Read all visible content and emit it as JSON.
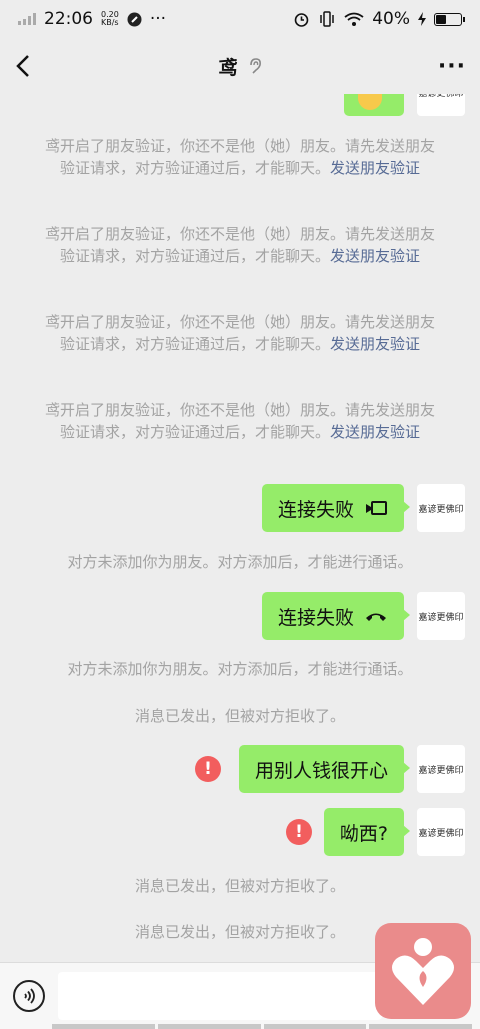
{
  "status_bar": {
    "time": "22:06",
    "net_speed_value": "0.20",
    "net_speed_unit": "KB/s",
    "extra_icons": "···",
    "battery_percent": "40%",
    "battery_level": 0.4
  },
  "header": {
    "title": "鸢",
    "more_label": "···"
  },
  "avatar_text": "嘉谚更佛印",
  "messages": {
    "verify_text": "鸢开启了朋友验证，你还不是他（她）朋友。请先发送朋友验证请求，对方验证通过后，才能聊天。",
    "verify_link": "发送朋友验证",
    "call_fail_video": "连接失败",
    "call_fail_voice": "连接失败",
    "not_added": "对方未添加你为朋友。对方添加后，才能进行通话。",
    "rejected": "消息已发出，但被对方拒收了。",
    "text1": "用别人钱很开心",
    "text2": "呦西?",
    "error_mark": "!"
  },
  "colors": {
    "bubble": "#95ec69",
    "link": "#576b95",
    "system_text": "#a3a3a3",
    "error": "#f25e5e",
    "widget": "#ea8b8b"
  },
  "icons": [
    "back-arrow-icon",
    "ear-icon",
    "video-call-icon",
    "phone-hangup-icon",
    "voice-input-icon",
    "heart-person-icon"
  ]
}
